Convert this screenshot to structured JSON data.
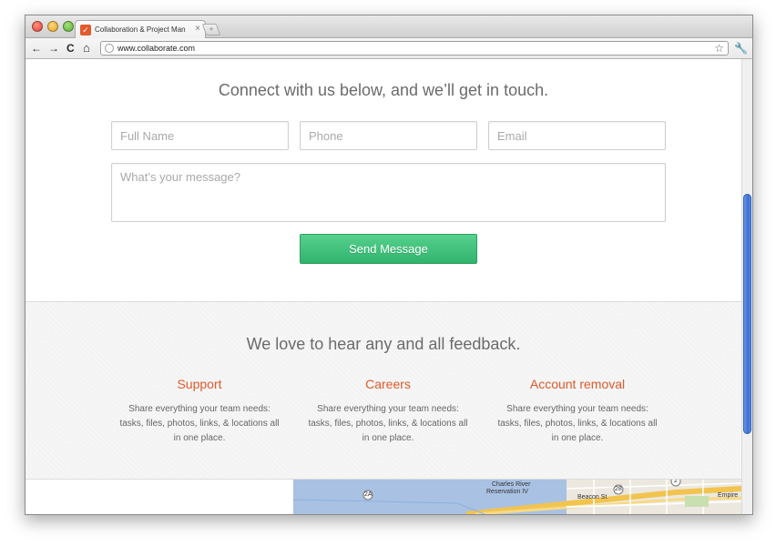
{
  "browser": {
    "tab_title": "Collaboration & Project Man",
    "tab_close": "×",
    "new_tab": "+",
    "url": "www.collaborate.com",
    "back_glyph": "←",
    "forward_glyph": "→",
    "reload_glyph": "C",
    "home_glyph": "⌂",
    "bookmark_glyph": "☆",
    "menu_glyph": "🔧"
  },
  "contact": {
    "heading": "Connect with us below, and we’ll get in touch.",
    "name_placeholder": "Full Name",
    "phone_placeholder": "Phone",
    "email_placeholder": "Email",
    "message_placeholder": "What’s your message?",
    "send_label": "Send Message"
  },
  "feedback": {
    "heading": "We love to hear any and all feedback.",
    "columns": [
      {
        "title": "Support",
        "text": "Share everything your team needs: tasks, files, photos, links, & locations all in one place."
      },
      {
        "title": "Careers",
        "text": "Share everything your team needs: tasks, files, photos, links, & locations all in one place."
      },
      {
        "title": "Account removal",
        "text": "Share everything your team needs: tasks, files, photos, links, & locations all in one place."
      }
    ]
  },
  "map": {
    "labels": [
      "Charles River",
      "Reservation IV",
      "Beacon St",
      "2A",
      "28",
      "2",
      "Empire"
    ]
  },
  "colors": {
    "accent_orange": "#e0592a",
    "send_green": "#3cbf78",
    "scroll_blue": "#4b7fdc"
  }
}
